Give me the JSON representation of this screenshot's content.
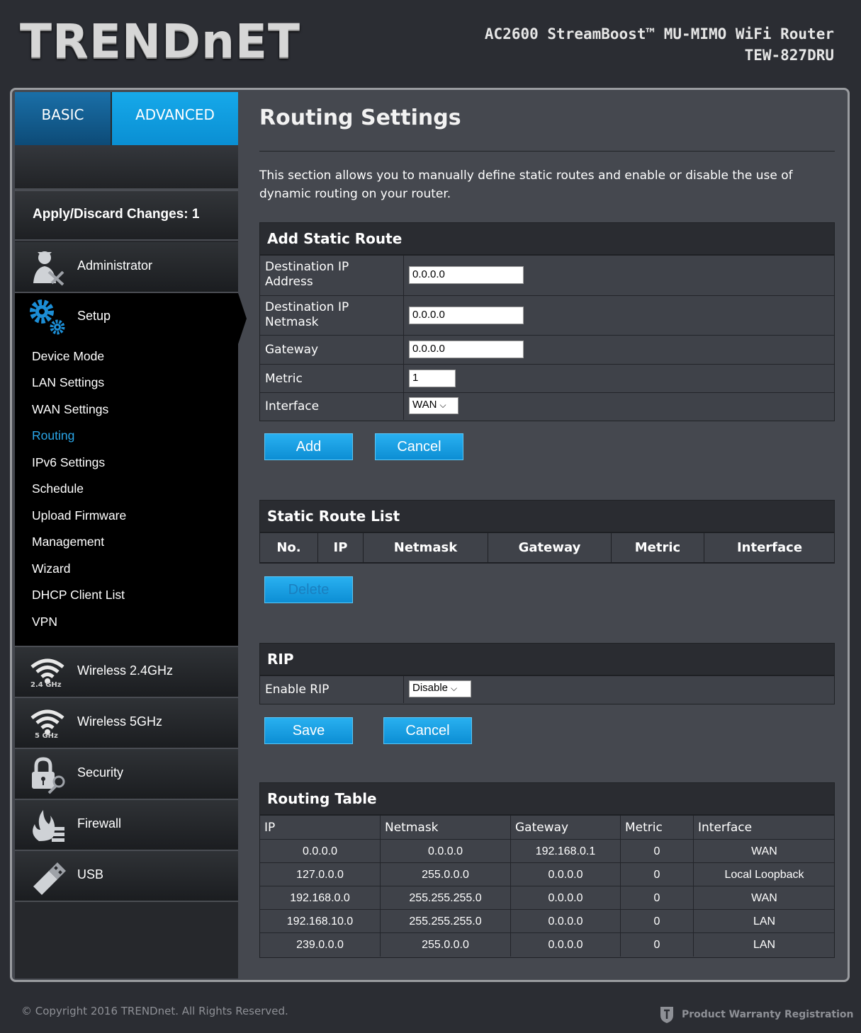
{
  "header": {
    "logo": "TRENDnET",
    "product_name": "AC2600 StreamBoost™ MU-MIMO WiFi Router",
    "model": "TEW-827DRU"
  },
  "tabs": {
    "basic": "BASIC",
    "advanced": "ADVANCED"
  },
  "apply": "Apply/Discard Changes: 1",
  "sidebar": {
    "administrator": "Administrator",
    "setup": "Setup",
    "setup_items": [
      "Device Mode",
      "LAN Settings",
      "WAN Settings",
      "Routing",
      "IPv6 Settings",
      "Schedule",
      "Upload Firmware",
      "Management",
      "Wizard",
      "DHCP Client List",
      "VPN"
    ],
    "wireless24": "Wireless 2.4GHz",
    "wireless24_badge": "2.4 GHz",
    "wireless5": "Wireless 5GHz",
    "wireless5_badge": "5 GHz",
    "security": "Security",
    "firewall": "Firewall",
    "usb": "USB"
  },
  "page": {
    "title": "Routing Settings",
    "description": "This section allows you to manually define static routes and enable or disable the use of dynamic routing on your router."
  },
  "add_static_route": {
    "heading": "Add Static Route",
    "dest_ip_label_1": "Destination IP",
    "dest_ip_label_2": "Address",
    "dest_ip_value": "0.0.0.0",
    "netmask_label_1": "Destination IP",
    "netmask_label_2": "Netmask",
    "netmask_value": "0.0.0.0",
    "gateway_label": "Gateway",
    "gateway_value": "0.0.0.0",
    "metric_label": "Metric",
    "metric_value": "1",
    "interface_label": "Interface",
    "interface_value": "WAN",
    "add_button": "Add",
    "cancel_button": "Cancel"
  },
  "static_route_list": {
    "heading": "Static Route List",
    "columns": [
      "No.",
      "IP",
      "Netmask",
      "Gateway",
      "Metric",
      "Interface"
    ],
    "delete_button": "Delete"
  },
  "rip": {
    "heading": "RIP",
    "enable_label": "Enable RIP",
    "enable_value": "Disable",
    "save_button": "Save",
    "cancel_button": "Cancel"
  },
  "routing_table": {
    "heading": "Routing Table",
    "columns": [
      "IP",
      "Netmask",
      "Gateway",
      "Metric",
      "Interface"
    ],
    "rows": [
      [
        "0.0.0.0",
        "0.0.0.0",
        "192.168.0.1",
        "0",
        "WAN"
      ],
      [
        "127.0.0.0",
        "255.0.0.0",
        "0.0.0.0",
        "0",
        "Local Loopback"
      ],
      [
        "192.168.0.0",
        "255.255.255.0",
        "0.0.0.0",
        "0",
        "WAN"
      ],
      [
        "192.168.10.0",
        "255.255.255.0",
        "0.0.0.0",
        "0",
        "LAN"
      ],
      [
        "239.0.0.0",
        "255.0.0.0",
        "0.0.0.0",
        "0",
        "LAN"
      ]
    ]
  },
  "footer": {
    "copyright": "© Copyright 2016 TRENDnet. All Rights Reserved.",
    "warranty": "Product Warranty Registration"
  },
  "colors": {
    "accent": "#0a8fd3",
    "active_link": "#2aa6e8",
    "background": "#2b2d33"
  }
}
